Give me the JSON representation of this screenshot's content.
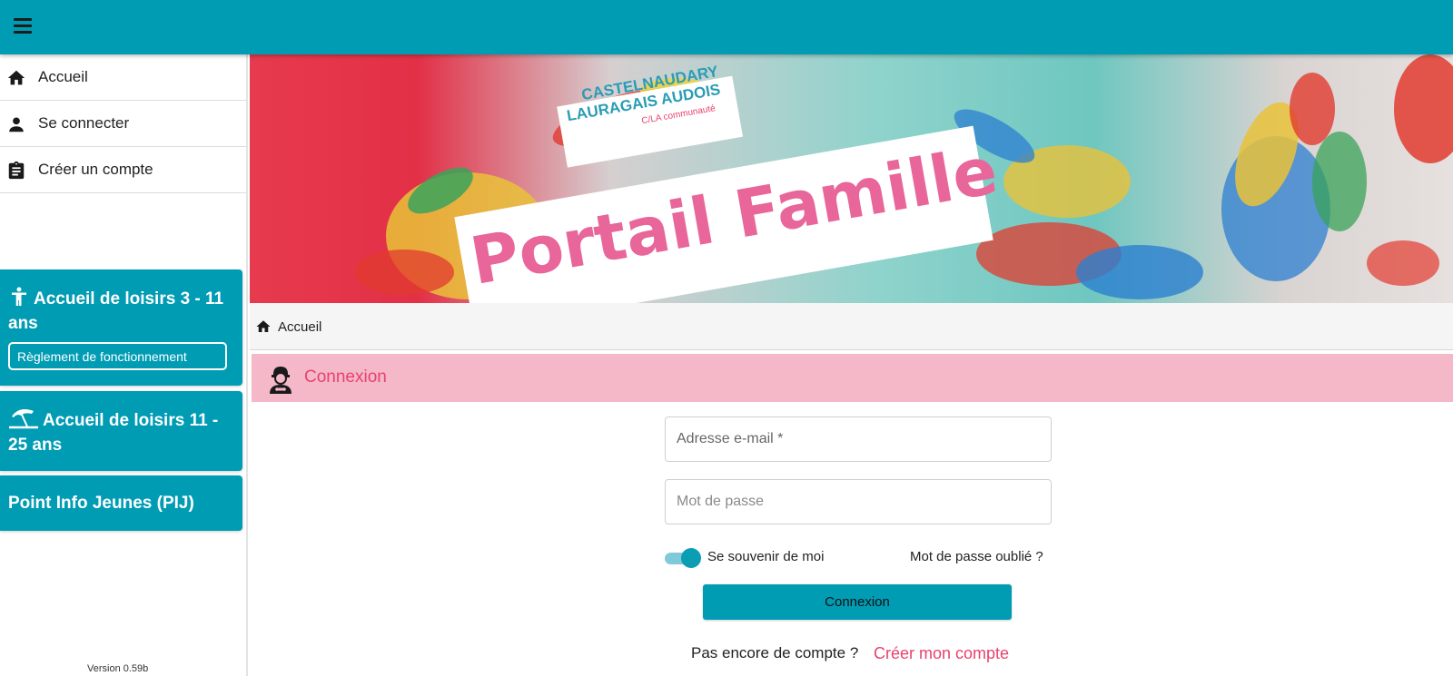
{
  "topbar": {
    "menu_icon": "hamburger-menu-icon"
  },
  "sidebar": {
    "items": [
      {
        "label": "Accueil",
        "icon": "home-icon"
      },
      {
        "label": "Se connecter",
        "icon": "person-icon"
      },
      {
        "label": "Créer un compte",
        "icon": "clipboard-icon"
      }
    ],
    "cards": [
      {
        "title": "Accueil de loisirs 3 - 11 ans",
        "icon": "child-icon",
        "button_label": "Règlement de fonctionnement"
      },
      {
        "title": "Accueil de loisirs 11 - 25 ans",
        "icon": "beach-umbrella-icon"
      },
      {
        "title": "Point Info Jeunes (PIJ)"
      }
    ],
    "version": "Version 0.59b"
  },
  "banner": {
    "logo_line1": "CASTELNAUDARY",
    "logo_line2": "LAURAGAIS AUDOIS",
    "logo_line3": "C/LA communauté",
    "title": "Portail Famille"
  },
  "breadcrumb": {
    "label": "Accueil",
    "icon": "home-icon"
  },
  "login": {
    "title": "Connexion",
    "icon": "user-secret-icon",
    "email_placeholder": "Adresse e-mail *",
    "password_placeholder": "Mot de passe",
    "remember_label": "Se souvenir de moi",
    "remember_checked": true,
    "forgot_label": "Mot de passe oublié ?",
    "submit_label": "Connexion",
    "no_account_text": "Pas encore de compte ?",
    "create_account_label": "Créer mon compte"
  },
  "colors": {
    "primary": "#009cb4",
    "accent": "#e8426f",
    "panel_header": "#f5b8c9"
  }
}
